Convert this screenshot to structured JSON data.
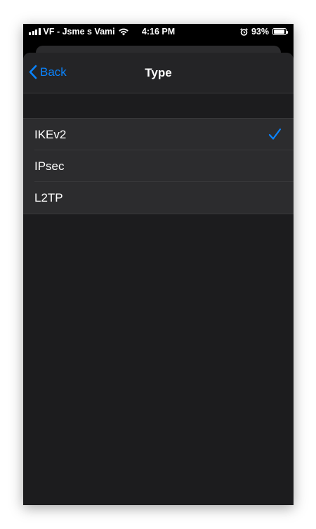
{
  "status_bar": {
    "carrier": "VF - Jsme s Vami",
    "time": "4:16 PM",
    "battery_percent": "93%",
    "battery_level": 0.93,
    "icons": [
      "signal-icon",
      "wifi-icon",
      "alarm-icon",
      "battery-icon"
    ]
  },
  "navbar": {
    "back_label": "Back",
    "title": "Type"
  },
  "list": {
    "items": [
      {
        "label": "IKEv2",
        "selected": true
      },
      {
        "label": "IPsec",
        "selected": false
      },
      {
        "label": "L2TP",
        "selected": false
      }
    ]
  },
  "colors": {
    "accent": "#0a84ff",
    "background": "#1c1c1e",
    "cell": "#2c2c2e"
  }
}
